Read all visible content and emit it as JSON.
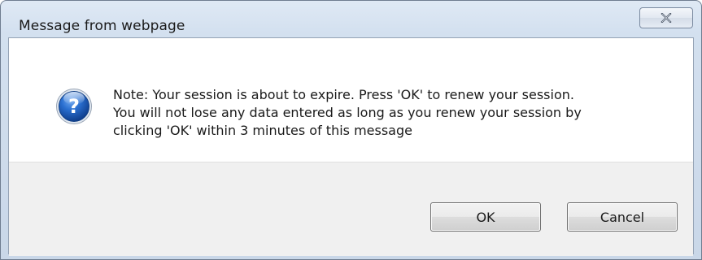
{
  "window": {
    "title": "Message from webpage",
    "close_icon": "close-x-icon"
  },
  "message": {
    "icon": "question-icon",
    "lines": [
      "Note: Your session is about to expire.  Press 'OK' to renew your session.",
      "You will not lose any data entered as long as you renew your session by",
      "clicking 'OK' within 3 minutes of this message"
    ]
  },
  "buttons": {
    "ok_label": "OK",
    "cancel_label": "Cancel"
  },
  "colors": {
    "icon_blue": "#1f5fb5",
    "titlebar": "#d3e0ef"
  }
}
